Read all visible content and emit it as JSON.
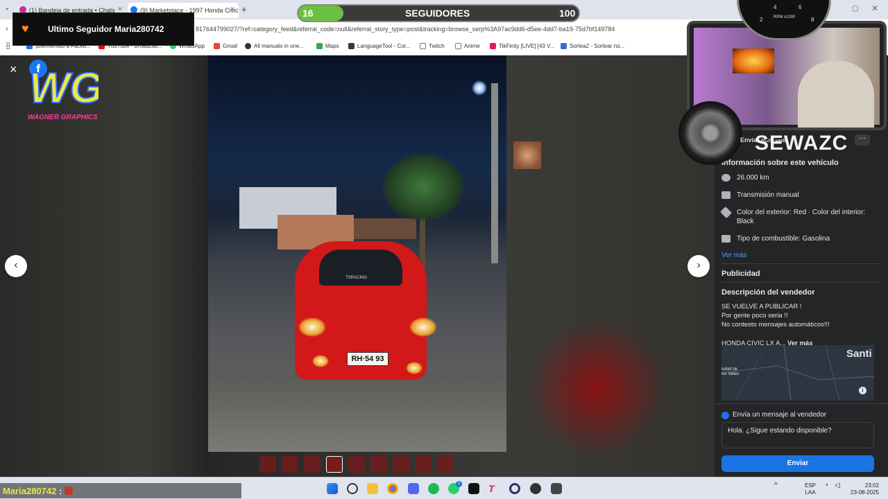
{
  "browser": {
    "tabs": [
      {
        "title": "(1) Bandeja de entrada • Chats",
        "favicon_color": "#d6249f"
      },
      {
        "title": "(9) Marketplace - 1997 Honda Civic",
        "favicon_color": "#1877f2"
      }
    ],
    "new_tab": "+",
    "url": "817644799027/?ref=category_feed&referral_code=null&referral_story_type=post&tracking=browse_serp%3A97ac9dd6-d5ee-4dd7-ba19-75d7bf149784",
    "bookmarks": [
      {
        "label": "¡Bienvenido a Faceb...",
        "color": "#1877f2"
      },
      {
        "label": "YouTube - Broadcas...",
        "color": "#ff0000"
      },
      {
        "label": "WhatsApp",
        "color": "#25d366"
      },
      {
        "label": "Gmail",
        "color": "#ea4335"
      },
      {
        "label": "All manuals in one...",
        "color": "#333333"
      },
      {
        "label": "Maps",
        "color": "#34a853"
      },
      {
        "label": "LanguageTool - Cor...",
        "color": "#3a3a3a"
      },
      {
        "label": "Twitch",
        "color": "#777777"
      },
      {
        "label": "Anime",
        "color": "#777777"
      },
      {
        "label": "TikFinity [LIVE] [43 V...",
        "color": "#e61e4d"
      },
      {
        "label": "Sortea2 - Sortear nú...",
        "color": "#3a6ad8"
      }
    ]
  },
  "overlay": {
    "last_follower": "Ultimo Seguidor Maria280742",
    "followers_goal_label": "SEGUIDORES",
    "followers_current": "16",
    "followers_target": "100",
    "followers_progress": 0.16,
    "streamer_name": "SEWAZC",
    "gauge_label": "RPM x1000",
    "gauge_ticks": [
      "2",
      "4",
      "6",
      "8"
    ],
    "logo_text": "WG",
    "logo_subtext": "WAGNER GRAPHICS",
    "chat_user": "Maria280742",
    "chat_sep": ":"
  },
  "viewer": {
    "plate": "RH·54 93",
    "windshield_sticker": "TSRACING",
    "close_icon": "×",
    "fb_letter": "f",
    "prev_icon": "‹",
    "next_icon": "›",
    "thumbnail_count": 9,
    "selected_thumbnail": 4
  },
  "panel": {
    "message_label_top": "Enviar mensaje",
    "more_icon": "···",
    "section_title": "Información sobre este vehículo",
    "specs": [
      {
        "icon": "odometer-icon",
        "text": "26.000 km"
      },
      {
        "icon": "transmission-icon",
        "text": "Transmisión manual"
      },
      {
        "icon": "paint-icon",
        "text": "Color del exterior: Red · Color del interior: Black"
      },
      {
        "icon": "fuel-icon",
        "text": "Tipo de combustible: Gasolina"
      }
    ],
    "see_more": "Ver más",
    "publicidad": "Publicidad",
    "seller_desc_title": "Descripción del vendedor",
    "seller_desc_lines": [
      "SE VUELVE A PUBLICAR !",
      "Por gente poco seria !!",
      "No contesto mensajes automáticos!!!"
    ],
    "seller_desc_more_prefix": "HONDA CIVIC LX A...",
    "seller_desc_more": "Ver más",
    "map_city": "Santi",
    "map_label": "iudad de los Valles",
    "send_msg_label": "Envía un mensaje al vendedor",
    "message_value": "Hola. ¿Sigue estando disponible?",
    "send_button": "Enviar"
  },
  "taskbar": {
    "language": "ESP",
    "language_sub": "LAA",
    "time": "23:02",
    "date": "23-08-2025",
    "whatsapp_badge": "1"
  },
  "colors": {
    "accent": "#1b74e4",
    "panel_bg": "#242526",
    "progress": "#6cc040"
  }
}
